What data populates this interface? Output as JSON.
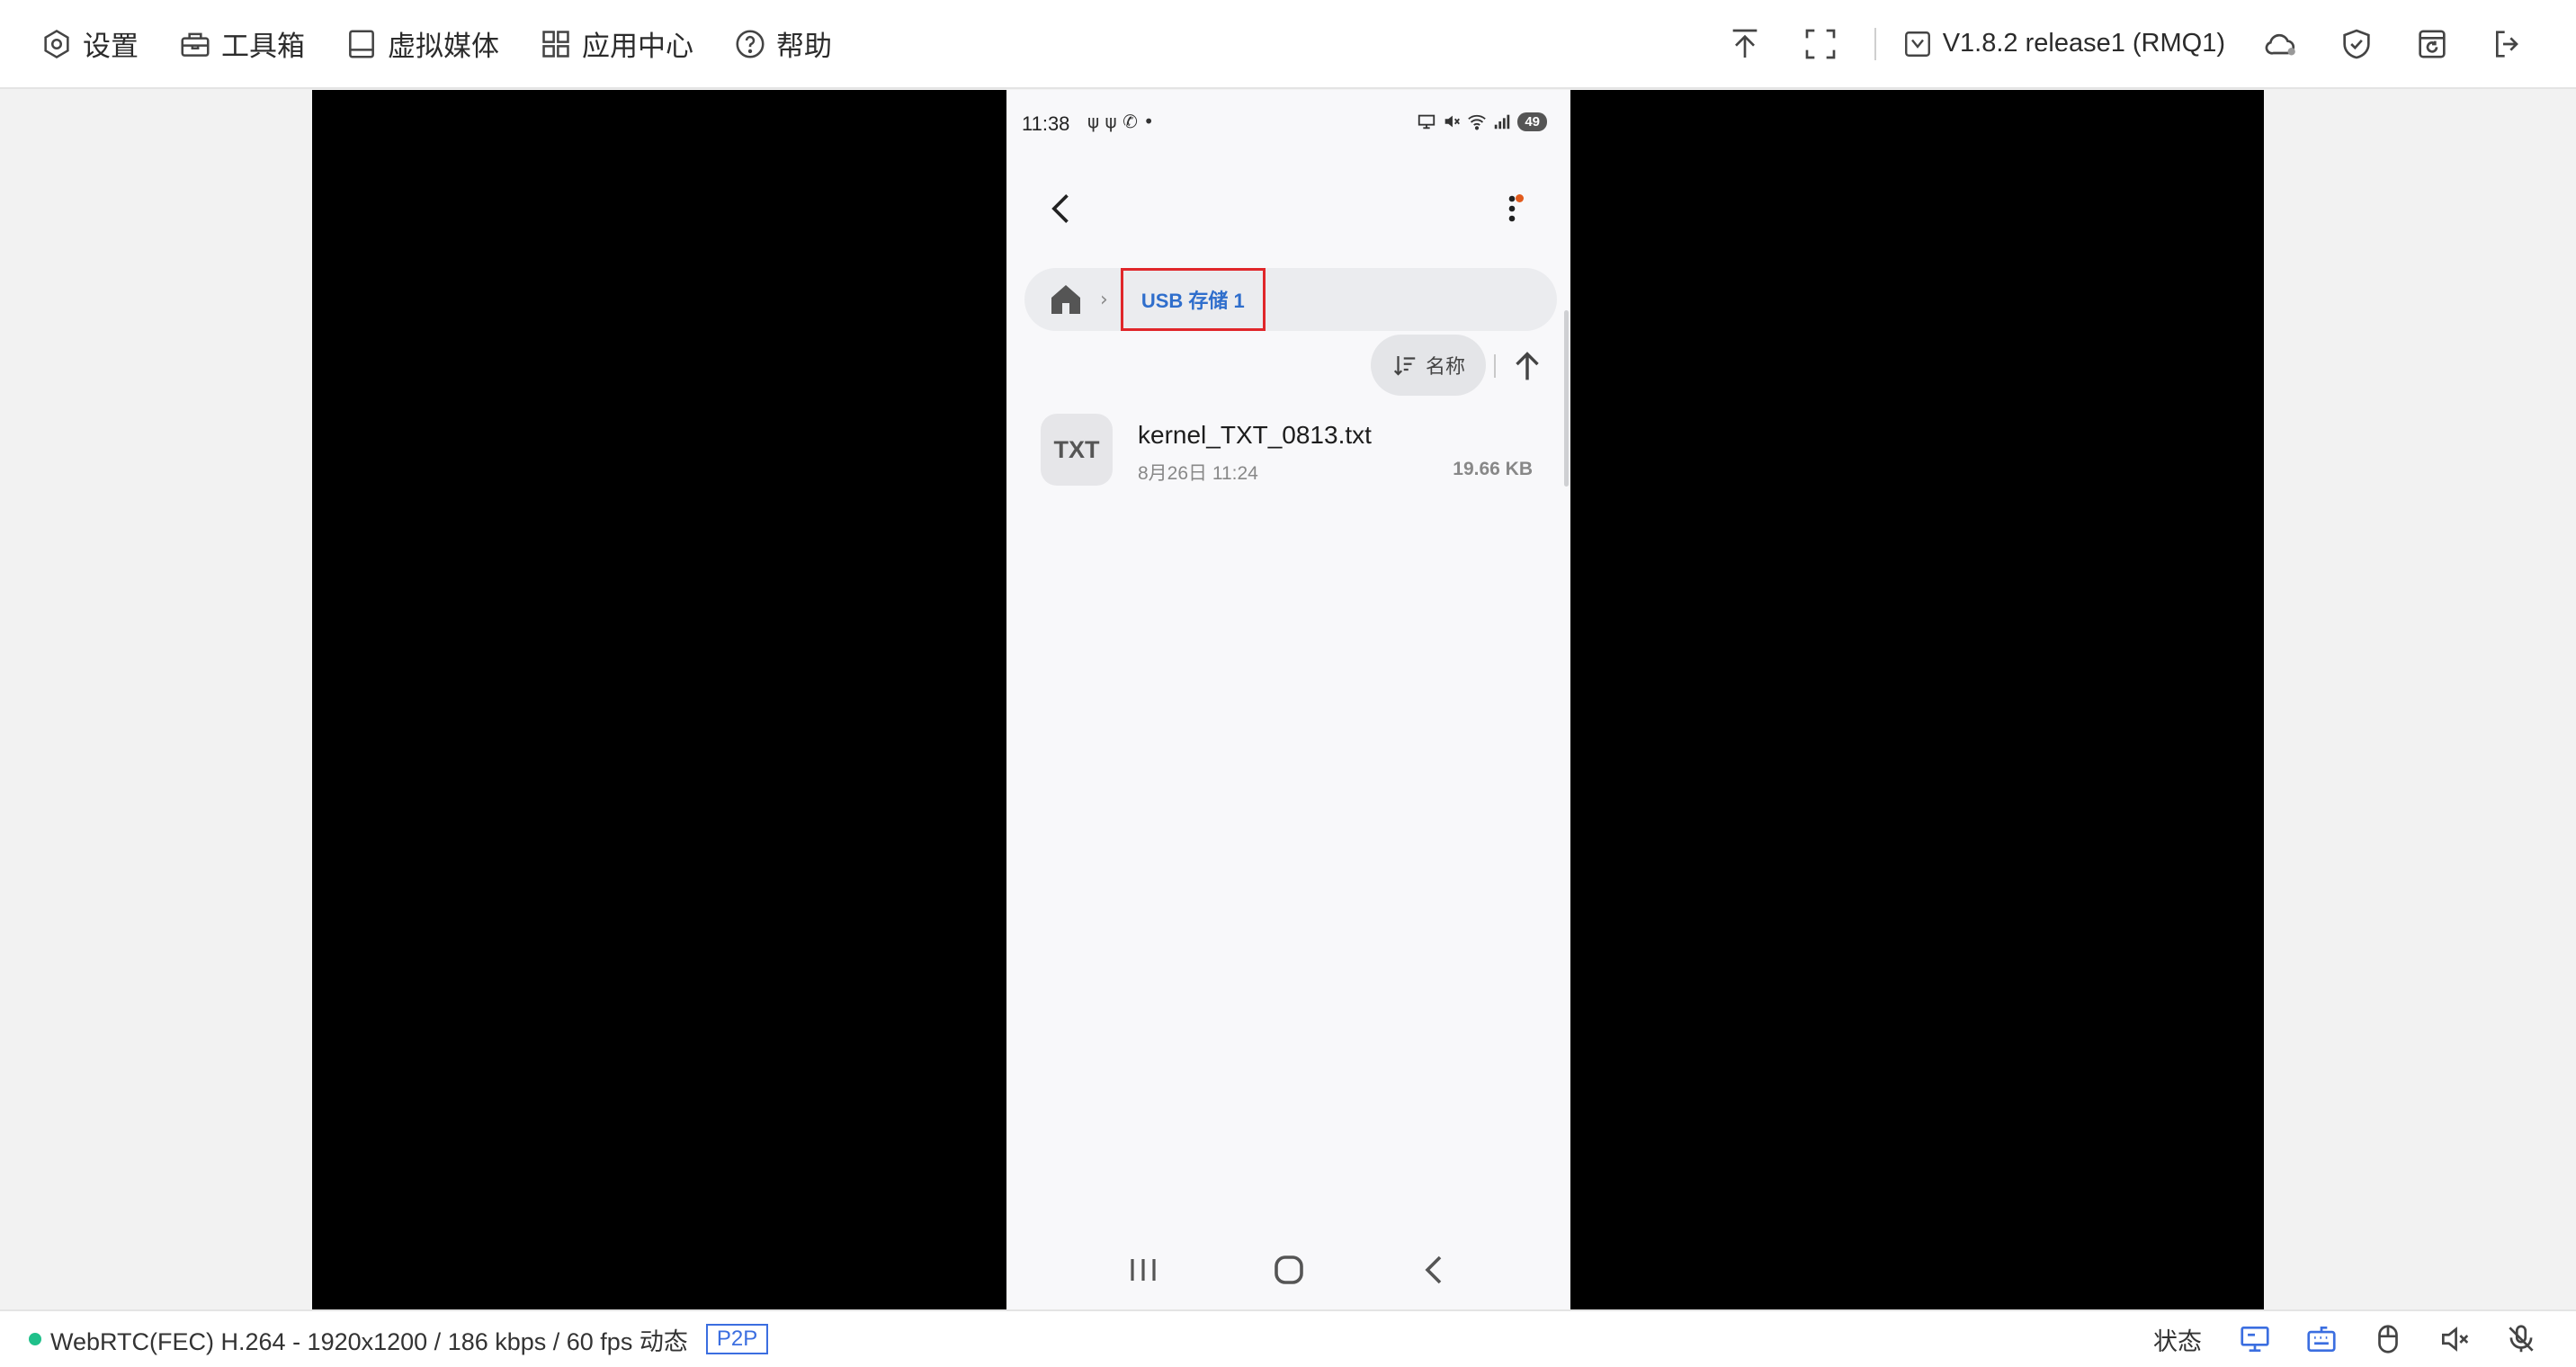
{
  "topbar": {
    "menu": [
      {
        "label": "设置",
        "icon": "gear-icon"
      },
      {
        "label": "工具箱",
        "icon": "toolbox-icon"
      },
      {
        "label": "虚拟媒体",
        "icon": "drive-icon"
      },
      {
        "label": "应用中心",
        "icon": "apps-grid-icon"
      },
      {
        "label": "帮助",
        "icon": "help-icon"
      }
    ],
    "version_label": "V1.8.2 release1 (RMQ1)"
  },
  "phone": {
    "status": {
      "time": "11:38",
      "left_icons": "ψ ψ ✆ •",
      "battery": "49"
    },
    "breadcrumb": {
      "current": "USB 存储 1"
    },
    "sort": {
      "label": "名称"
    },
    "files": [
      {
        "badge": "TXT",
        "name": "kernel_TXT_0813.txt",
        "date": "8月26日 11:24",
        "size": "19.66 KB"
      }
    ]
  },
  "bottombar": {
    "stream": "WebRTC(FEC) H.264 - 1920x1200 / 186 kbps / 60 fps 动态",
    "p2p": "P2P",
    "state_label": "状态"
  },
  "colors": {
    "accent": "#3b6ee0",
    "highlight_border": "#e0262a",
    "connected": "#1fc08a"
  }
}
